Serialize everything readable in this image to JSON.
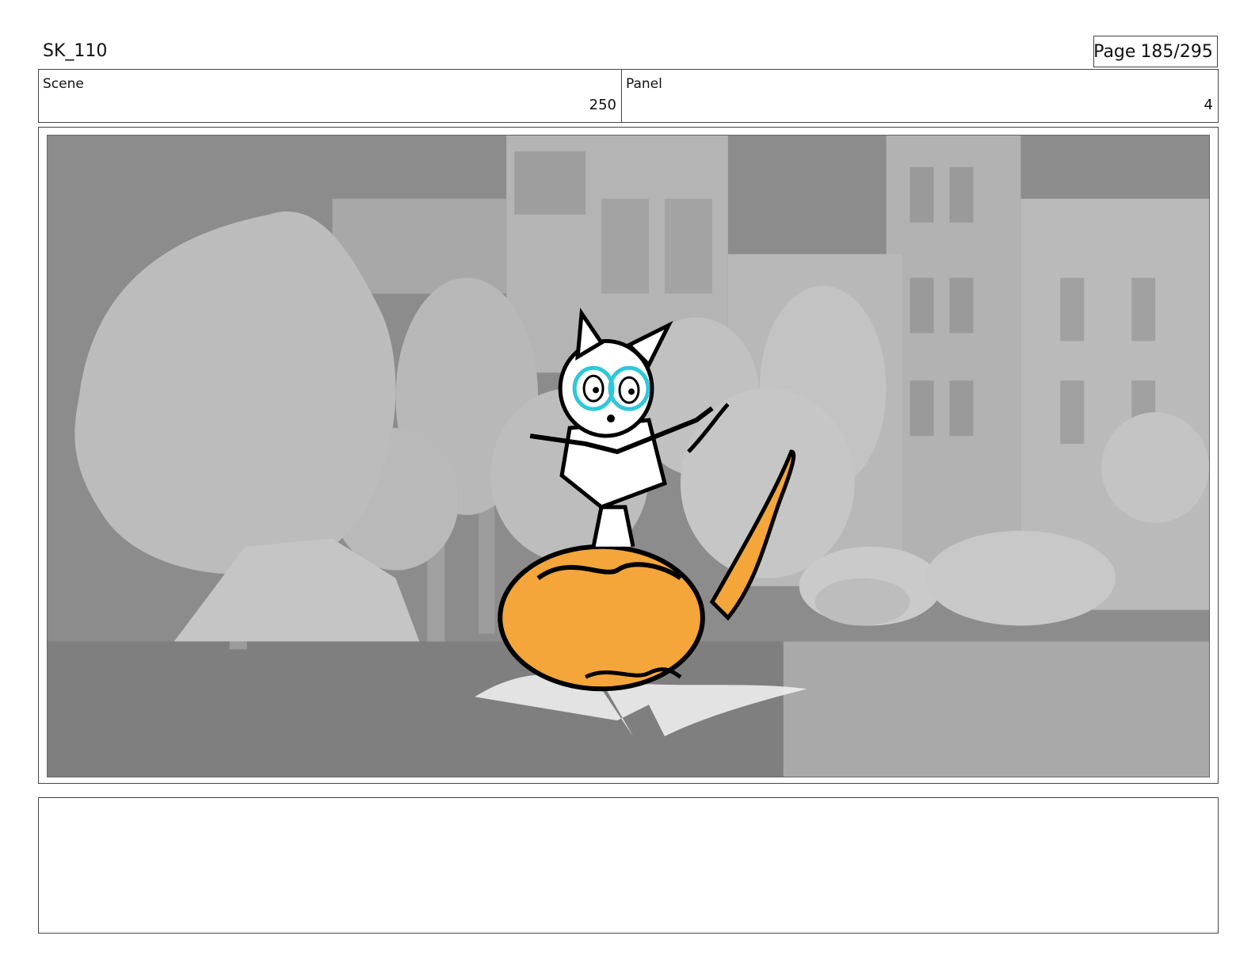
{
  "header": {
    "title": "SK_110",
    "page_label": "Page",
    "page_value": "185/295"
  },
  "info": {
    "scene_label": "Scene",
    "scene_value": "250",
    "panel_label": "Panel",
    "panel_value": "4"
  },
  "panel_image": {
    "description_colors": {
      "background": "#8f8f8f",
      "ball": "#f4a63a",
      "accent": "#2ec8d8"
    }
  },
  "notes": {
    "text": ""
  }
}
